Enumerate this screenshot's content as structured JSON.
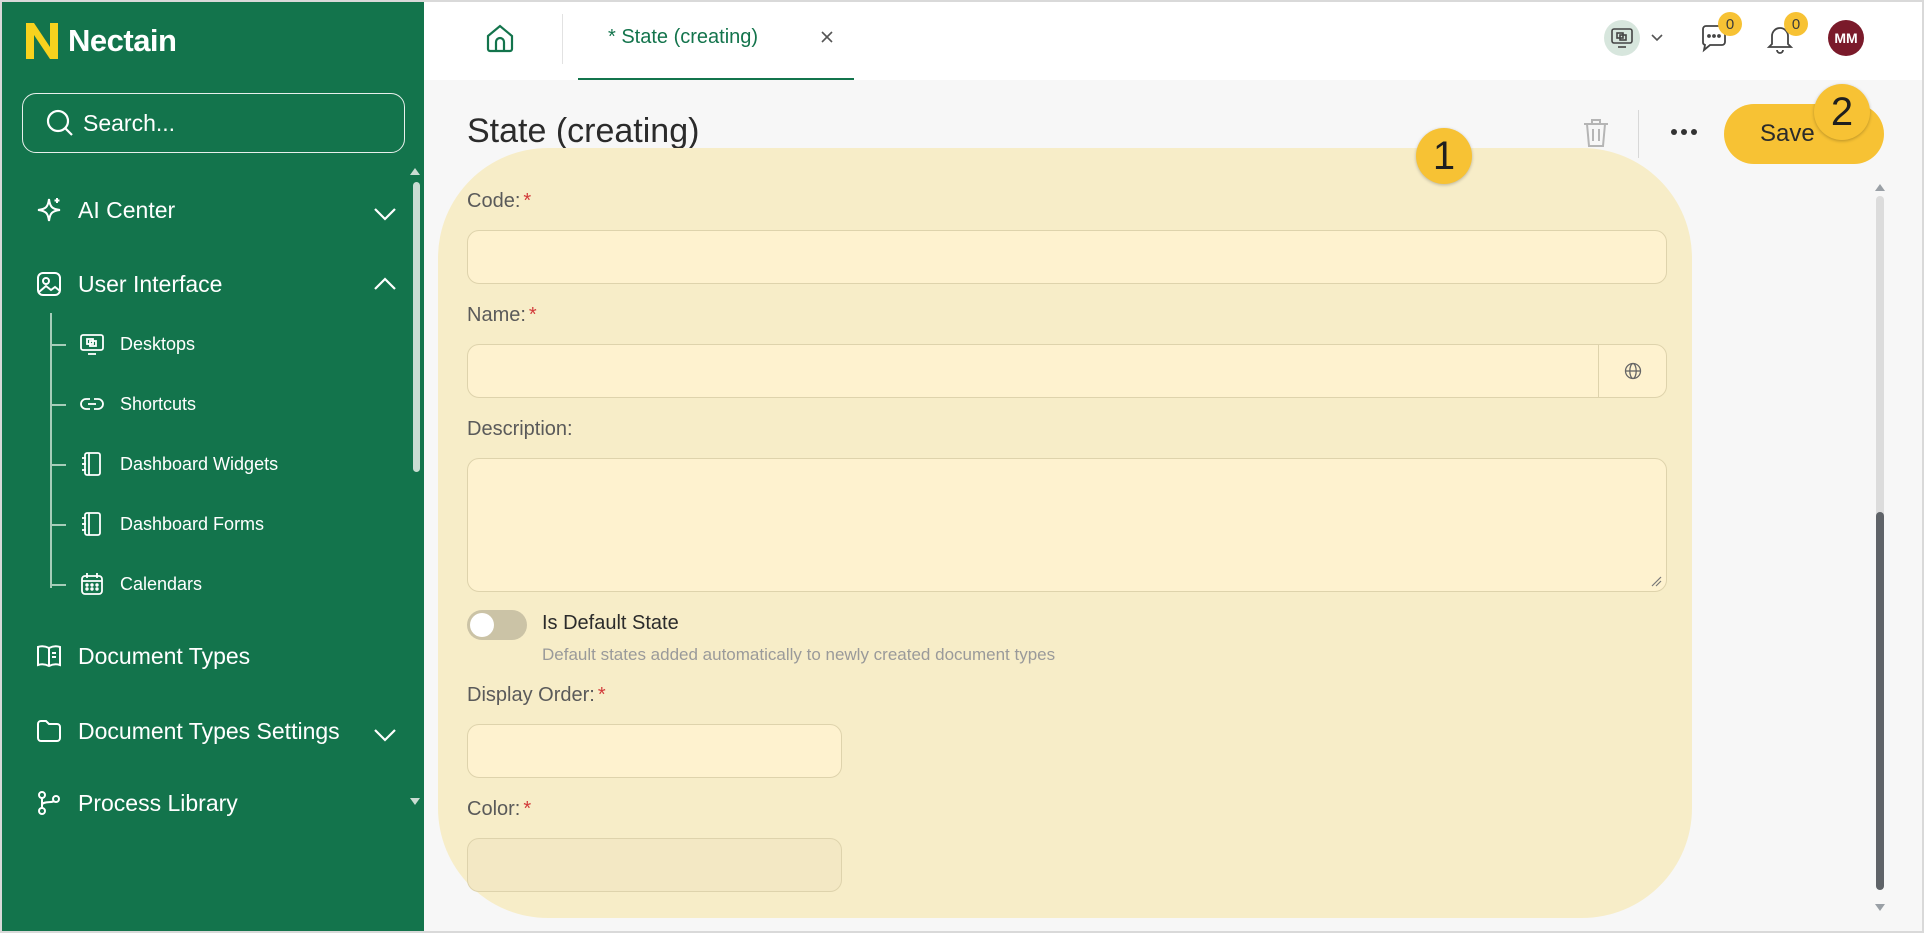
{
  "app": {
    "name": "Nectain"
  },
  "sidebar": {
    "search_placeholder": "Search...",
    "items": [
      {
        "label": "AI Center",
        "icon": "sparkles-icon",
        "expanded": false
      },
      {
        "label": "User Interface",
        "icon": "image-icon",
        "expanded": true,
        "children": [
          {
            "label": "Desktops",
            "icon": "desktops-icon"
          },
          {
            "label": "Shortcuts",
            "icon": "link-icon"
          },
          {
            "label": "Dashboard Widgets",
            "icon": "notebook-icon"
          },
          {
            "label": "Dashboard Forms",
            "icon": "notebook-icon"
          },
          {
            "label": "Calendars",
            "icon": "calendar-icon"
          }
        ]
      },
      {
        "label": "Document Types",
        "icon": "book-icon"
      },
      {
        "label": "Document Types Settings",
        "icon": "folder-icon",
        "expanded": false
      },
      {
        "label": "Process Library",
        "icon": "process-icon"
      }
    ]
  },
  "topbar": {
    "tab_label": "* State (creating)",
    "chat_count": "0",
    "notification_count": "0",
    "avatar_initials": "MM"
  },
  "page": {
    "title": "State (creating)",
    "save_label": "Save",
    "markers": [
      "1",
      "2"
    ]
  },
  "form": {
    "code_label": "Code:",
    "name_label": "Name:",
    "description_label": "Description:",
    "default_state_label": "Is Default State",
    "default_state_help": "Default states added automatically to newly created document types",
    "default_state_on": false,
    "display_order_label": "Display Order:",
    "color_label": "Color:",
    "required_mark": "*"
  },
  "colors": {
    "sidebar": "#13744c",
    "accent": "#f7c234",
    "highlight": "#f7edc8",
    "avatar": "#7a1a2a",
    "required": "#d23a3a"
  }
}
